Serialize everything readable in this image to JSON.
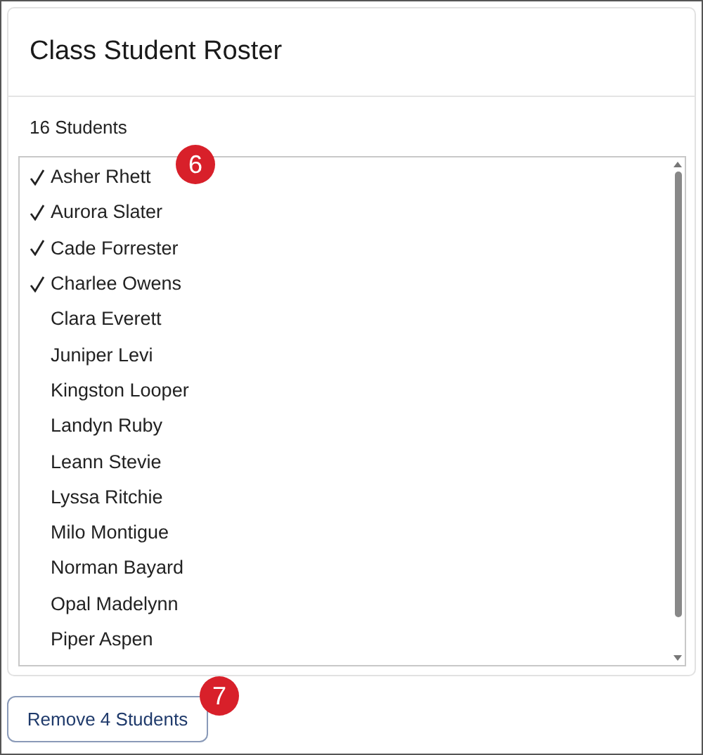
{
  "card": {
    "title": "Class Student Roster",
    "count": "16 Students"
  },
  "students": [
    {
      "name": "Asher Rhett",
      "selected": true
    },
    {
      "name": "Aurora Slater",
      "selected": true
    },
    {
      "name": "Cade Forrester",
      "selected": true
    },
    {
      "name": "Charlee Owens",
      "selected": true
    },
    {
      "name": "Clara Everett",
      "selected": false
    },
    {
      "name": "Juniper Levi",
      "selected": false
    },
    {
      "name": "Kingston Looper",
      "selected": false
    },
    {
      "name": "Landyn Ruby",
      "selected": false
    },
    {
      "name": "Leann Stevie",
      "selected": false
    },
    {
      "name": "Lyssa Ritchie",
      "selected": false
    },
    {
      "name": "Milo Montigue",
      "selected": false
    },
    {
      "name": "Norman Bayard",
      "selected": false
    },
    {
      "name": "Opal Madelynn",
      "selected": false
    },
    {
      "name": "Piper Aspen",
      "selected": false
    }
  ],
  "callouts": [
    "6",
    "7"
  ],
  "button": "Remove 4 Students"
}
